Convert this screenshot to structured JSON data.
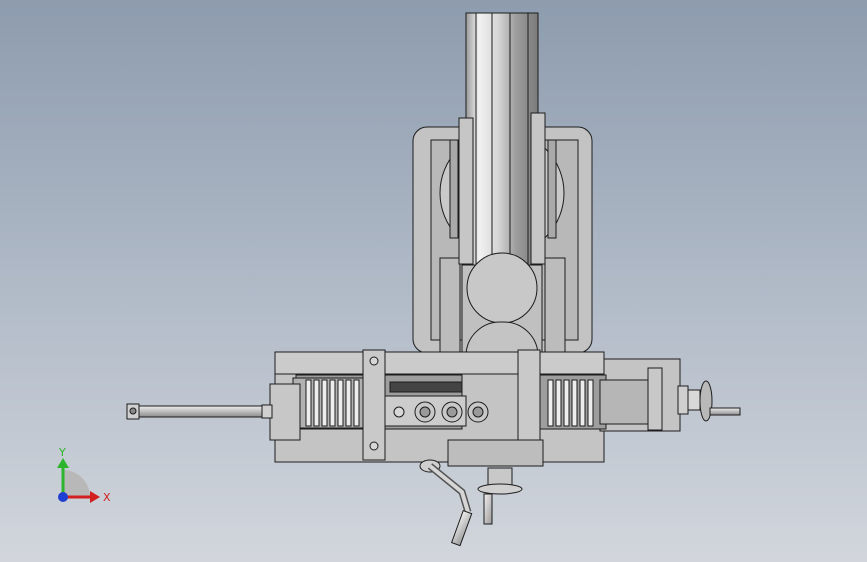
{
  "viewport": {
    "background_top": "#8d9cae",
    "background_bottom": "#d2d6dc"
  },
  "triad": {
    "x_label": "X",
    "y_label": "Y",
    "x_color": "#d21f1f",
    "y_color": "#2db52d",
    "z_color": "#1f3fd2"
  },
  "model": {
    "part_fill": "#c2c2c2",
    "part_dark": "#8a8a8a",
    "edge_color": "#1c1c1c"
  }
}
